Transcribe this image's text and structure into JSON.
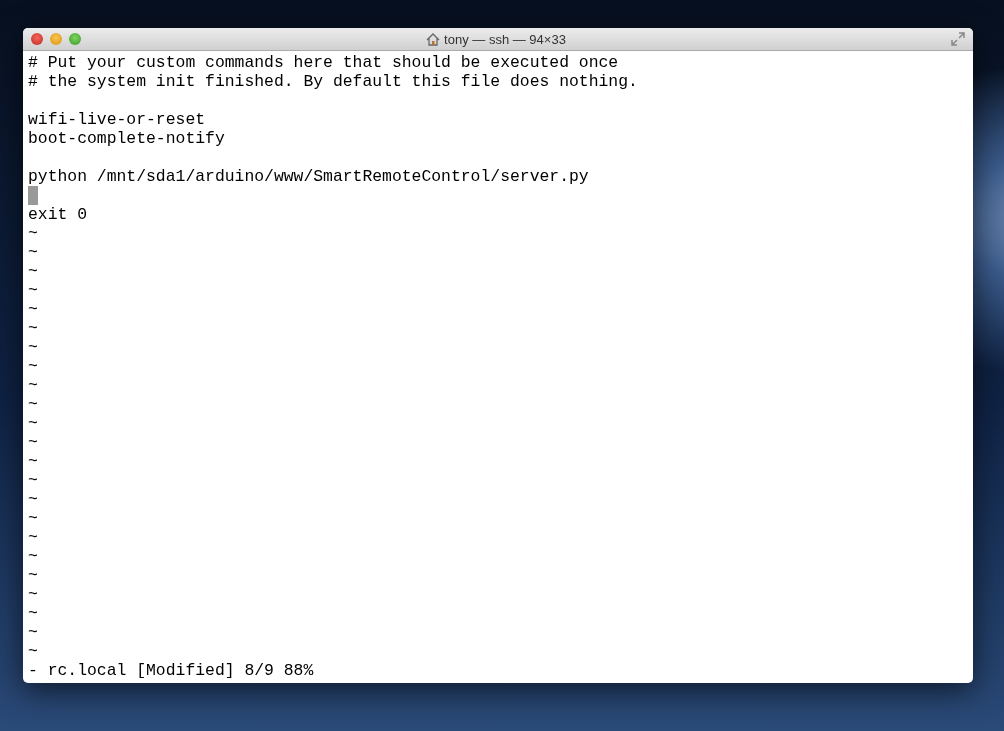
{
  "window": {
    "title": "tony — ssh — 94×33"
  },
  "buffer": {
    "lines": [
      {
        "text": "# Put your custom commands here that should be executed once",
        "cursor": false
      },
      {
        "text": "# the system init finished. By default this file does nothing.",
        "cursor": false
      },
      {
        "cursor": false
      },
      {
        "text": "wifi-live-or-reset",
        "cursor": false
      },
      {
        "text": "boot-complete-notify",
        "cursor": false
      },
      {
        "cursor": false
      },
      {
        "text": "python /mnt/sda1/arduino/www/SmartRemoteControl/server.py",
        "cursor": false
      },
      {
        "cursor": true
      },
      {
        "text": "exit 0",
        "cursor": false
      },
      {
        "text": "~",
        "cursor": false
      },
      {
        "text": "~",
        "cursor": false
      },
      {
        "text": "~",
        "cursor": false
      },
      {
        "text": "~",
        "cursor": false
      },
      {
        "text": "~",
        "cursor": false
      },
      {
        "text": "~",
        "cursor": false
      },
      {
        "text": "~",
        "cursor": false
      },
      {
        "text": "~",
        "cursor": false
      },
      {
        "text": "~",
        "cursor": false
      },
      {
        "text": "~",
        "cursor": false
      },
      {
        "text": "~",
        "cursor": false
      },
      {
        "text": "~",
        "cursor": false
      },
      {
        "text": "~",
        "cursor": false
      },
      {
        "text": "~",
        "cursor": false
      },
      {
        "text": "~",
        "cursor": false
      },
      {
        "text": "~",
        "cursor": false
      },
      {
        "text": "~",
        "cursor": false
      },
      {
        "text": "~",
        "cursor": false
      },
      {
        "text": "~",
        "cursor": false
      },
      {
        "text": "~",
        "cursor": false
      },
      {
        "text": "~",
        "cursor": false
      },
      {
        "text": "~",
        "cursor": false
      },
      {
        "text": "~",
        "cursor": false
      }
    ]
  },
  "status_line": "- rc.local [Modified] 8/9 88%"
}
